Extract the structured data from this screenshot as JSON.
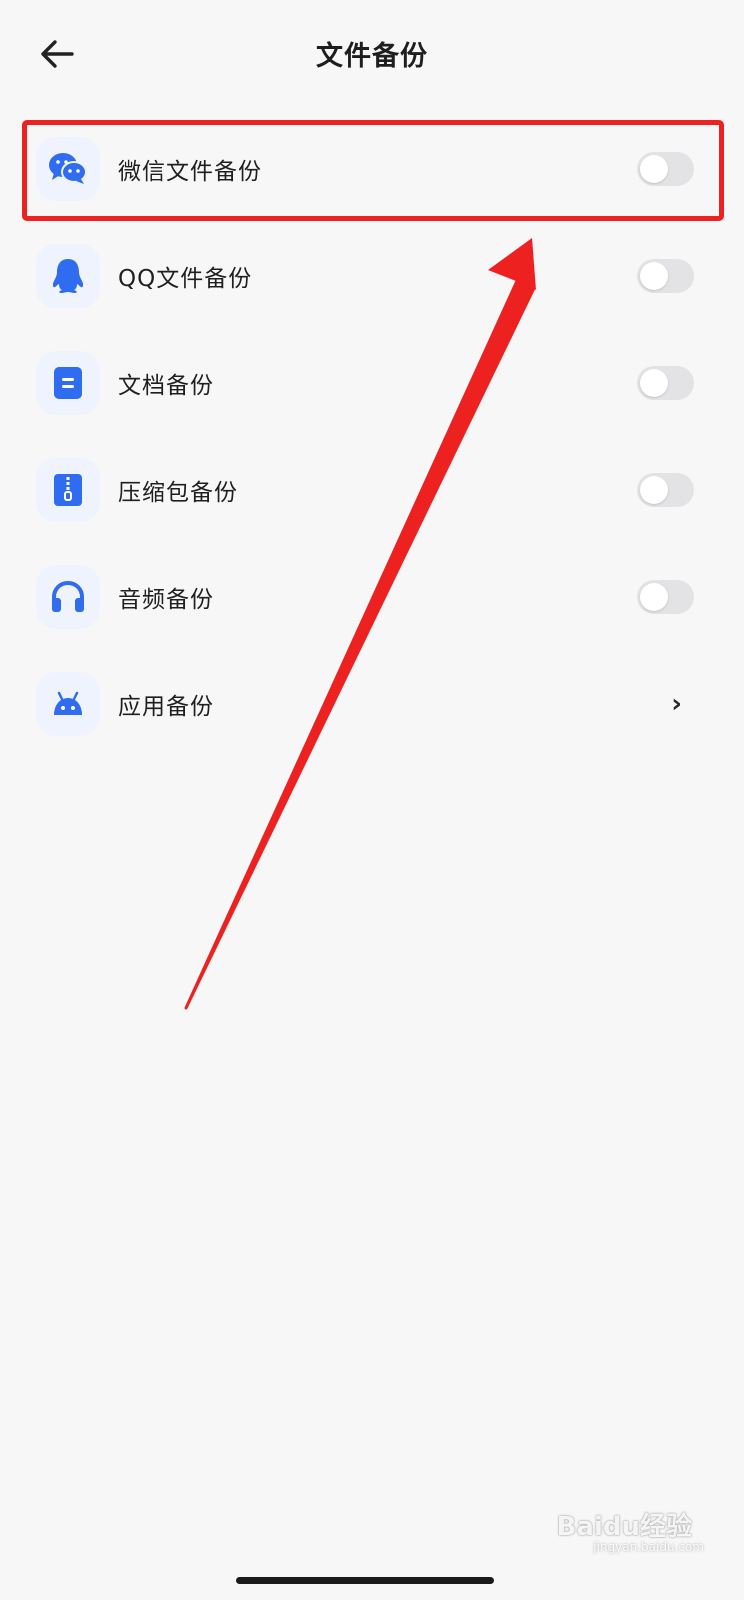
{
  "header": {
    "title": "文件备份",
    "back_icon": "arrow-left-icon"
  },
  "rows": [
    {
      "label": "微信文件备份",
      "icon": "wechat-icon",
      "control": "toggle",
      "enabled": false
    },
    {
      "label": "QQ文件备份",
      "icon": "qq-penguin-icon",
      "control": "toggle",
      "enabled": false
    },
    {
      "label": "文档备份",
      "icon": "document-icon",
      "control": "toggle",
      "enabled": false
    },
    {
      "label": "压缩包备份",
      "icon": "zip-file-icon",
      "control": "toggle",
      "enabled": false
    },
    {
      "label": "音频备份",
      "icon": "headphones-icon",
      "control": "toggle",
      "enabled": false
    },
    {
      "label": "应用备份",
      "icon": "android-icon",
      "control": "chevron",
      "chevron_text": "›"
    }
  ],
  "watermark": {
    "text": "Baidu经验",
    "sub": "jingyan.baidu.com"
  },
  "colors": {
    "accent_blue": "#2f6cf0",
    "annotation_red": "#ee2121",
    "toggle_off": "#e3e3e5",
    "background": "#f7f7f8"
  }
}
